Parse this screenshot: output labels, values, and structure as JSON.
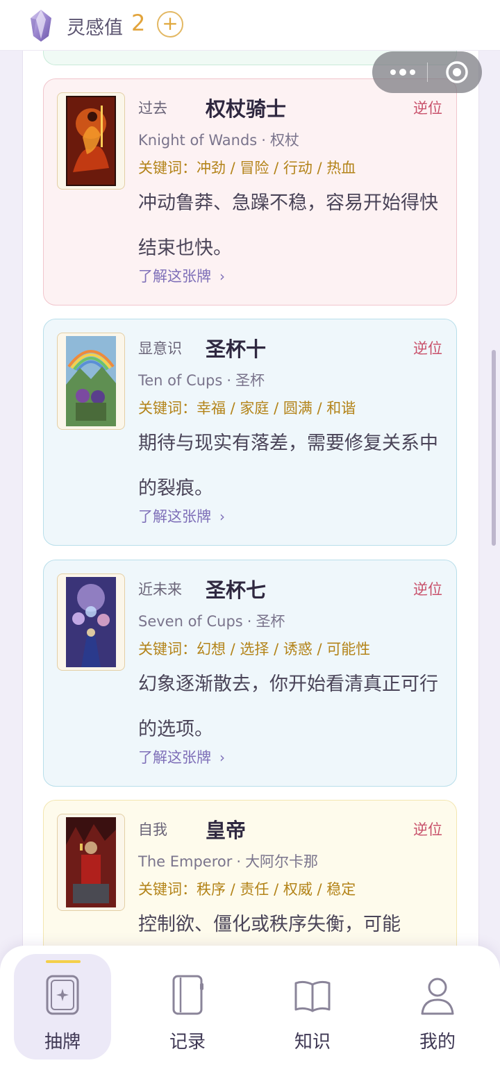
{
  "header": {
    "inspiration_label": "灵感值",
    "inspiration_value": "2",
    "add_label": "+"
  },
  "cards": [
    {
      "position": "过去",
      "name_cn": "权杖骑士",
      "orientation": "逆位",
      "name_en": "Knight of Wands",
      "suit": "权杖",
      "keywords": "关键词：冲劲 / 冒险 / 行动 / 热血",
      "description": "冲动鲁莽、急躁不稳，容易开始得快结束也快。",
      "learn_more": "了解这张牌",
      "theme": "pink",
      "art_icon": "knight-of-wands-art"
    },
    {
      "position": "显意识",
      "name_cn": "圣杯十",
      "orientation": "逆位",
      "name_en": "Ten of Cups",
      "suit": "圣杯",
      "keywords": "关键词：幸福 / 家庭 / 圆满 / 和谐",
      "description": "期待与现实有落差，需要修复关系中的裂痕。",
      "learn_more": "了解这张牌",
      "theme": "blue",
      "art_icon": "ten-of-cups-art"
    },
    {
      "position": "近未来",
      "name_cn": "圣杯七",
      "orientation": "逆位",
      "name_en": "Seven of Cups",
      "suit": "圣杯",
      "keywords": "关键词：幻想 / 选择 / 诱惑 / 可能性",
      "description": "幻象逐渐散去，你开始看清真正可行的选项。",
      "learn_more": "了解这张牌",
      "theme": "blue",
      "art_icon": "seven-of-cups-art"
    },
    {
      "position": "自我",
      "name_cn": "皇帝",
      "orientation": "逆位",
      "name_en": "The Emperor",
      "suit": "大阿尔卡那",
      "keywords": "关键词：秩序 / 责任 / 权威 / 稳定",
      "description": "控制欲、僵化或秩序失衡，可能",
      "learn_more": "",
      "theme": "yellow",
      "art_icon": "the-emperor-art"
    }
  ],
  "nav": {
    "items": [
      {
        "label": "抽牌",
        "icon": "tarot-card-icon",
        "active": true
      },
      {
        "label": "记录",
        "icon": "notebook-icon",
        "active": false
      },
      {
        "label": "知识",
        "icon": "book-icon",
        "active": false
      },
      {
        "label": "我的",
        "icon": "user-icon",
        "active": false
      }
    ]
  },
  "colors": {
    "accent_purple": "#7e6fb8",
    "reversed_red": "#c8506a",
    "keyword_gold": "#b38318",
    "active_indicator": "#f4cf4a"
  }
}
